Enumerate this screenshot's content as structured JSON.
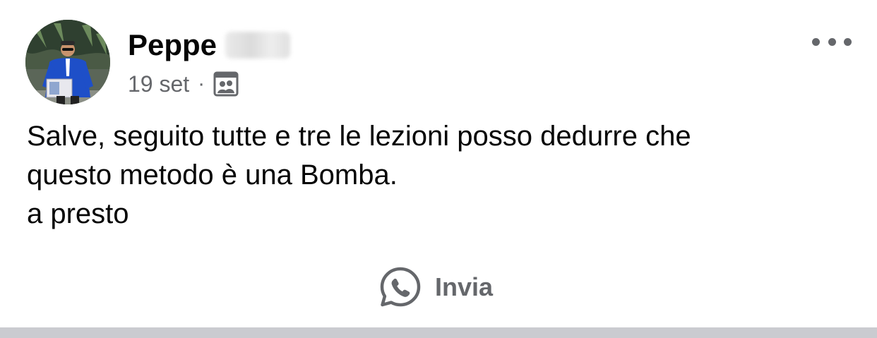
{
  "post": {
    "author_name": "Peppe",
    "date": "19 set",
    "separator": "·",
    "audience_icon": "photo-album-icon",
    "more_icon": "more-horizontal-icon",
    "text_lines": [
      "Salve, seguito tutte e tre le lezioni posso dedurre che",
      "questo metodo è una Bomba.",
      "a presto"
    ],
    "share": {
      "label": "Invia",
      "icon": "whatsapp-icon"
    }
  },
  "colors": {
    "text_primary": "#050505",
    "text_secondary": "#65676b",
    "divider": "#cacbd0",
    "avatar_jacket": "#1e4fc8"
  }
}
